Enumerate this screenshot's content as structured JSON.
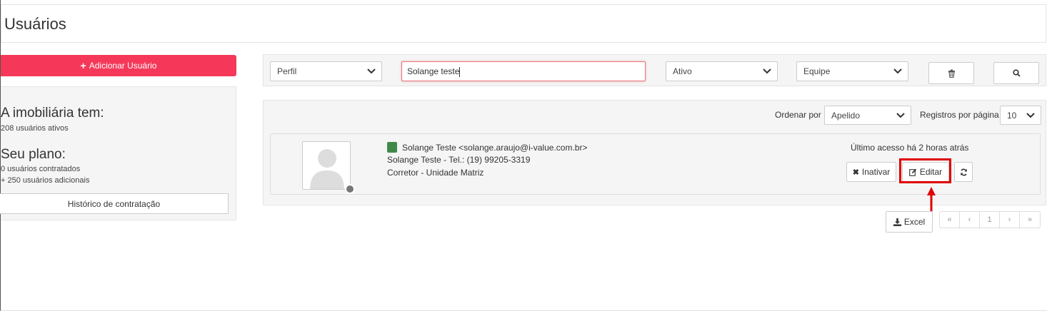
{
  "page": {
    "title": "Usuários"
  },
  "sidebar": {
    "add_user_label": "Adicionar Usuário",
    "agency_heading": "A imobiliária tem:",
    "active_users": "208 usuários ativos",
    "plan_heading": "Seu plano:",
    "contracted_users": "0 usuários contratados",
    "additional_users": "+ 250 usuários adicionais",
    "history_button": "Histórico de contratação"
  },
  "filters": {
    "profile_select": "Perfil",
    "search_value": "Solange teste",
    "status_select": "Ativo",
    "team_select": "Equipe"
  },
  "results": {
    "order_by_label": "Ordenar por",
    "order_by_value": "Apelido",
    "per_page_label": "Registros por página",
    "per_page_value": "10"
  },
  "user": {
    "name_email": "Solange Teste <solange.araujo@i-value.com.br>",
    "phone_line": "Solange Teste - Tel.: (19) 99205-3319",
    "role_line": "Corretor  - Unidade Matriz",
    "last_access": "Último acesso há 2 horas atrás",
    "deactivate_label": "Inativar",
    "edit_label": "Editar",
    "status_color": "#3f8a4a"
  },
  "footer": {
    "excel_label": "Excel",
    "pagination": {
      "first": "«",
      "prev": "‹",
      "current": "1",
      "next": "›",
      "last": "»"
    }
  },
  "colors": {
    "accent": "#f5385a",
    "highlight": "#e00000"
  }
}
